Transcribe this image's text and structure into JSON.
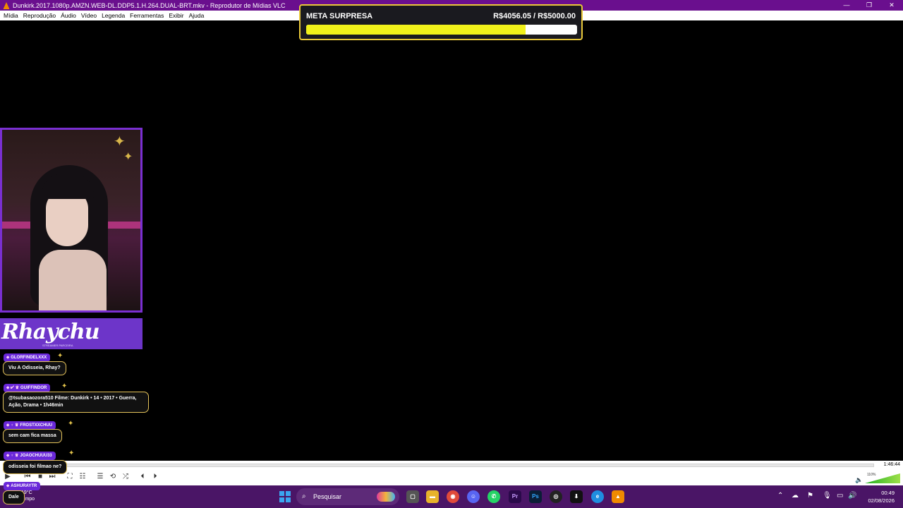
{
  "window": {
    "title": "Dunkirk.2017.1080p.AMZN.WEB-DL.DDP5.1.H.264.DUAL-BRT.mkv - Reprodutor de Mídias VLC",
    "minimize": "—",
    "maximize": "❐",
    "close": "✕"
  },
  "menu": [
    "Mídia",
    "Reprodução",
    "Áudio",
    "Vídeo",
    "Legenda",
    "Ferramentas",
    "Exibir",
    "Ajuda"
  ],
  "goal": {
    "title": "META SURPRESA",
    "amount": "R$4056.05 / R$5000.00",
    "progress": 0.811,
    "fill_color": "#f1f11a",
    "border_color": "#e9c83a"
  },
  "overlay": {
    "streamer_name": "Rhaychu",
    "banner_sub": "STREAMER PARCEIRA",
    "accent": "#6d35c9"
  },
  "chat": [
    {
      "user": "GLORFINDELXXX",
      "badges": "⬥",
      "message": "Viu A Odisseia, Rhay?"
    },
    {
      "user": "GUIFFINDOR",
      "badges": "⬥ ✔ ♛",
      "message": "@tsubasaozora510 Filme: Dunkirk • 14 • 2017 • Guerra, Ação, Drama • 1h46min"
    },
    {
      "user": "FROSTXXCHUU",
      "badges": "⬥ ♆ ♛",
      "message": "sem cam fica massa"
    },
    {
      "user": "JOAOCHUUU33",
      "badges": "⬥ ♆ ♛",
      "message": "odisseia foi filmao ne?"
    },
    {
      "user": "ASHURAYTR",
      "badges": "⬥",
      "message": "Dale"
    }
  ],
  "player": {
    "duration": "1:46:44",
    "position_fraction": 0.0,
    "volume": "110%",
    "volume_fraction": 1.0
  },
  "taskbar": {
    "weather_temp": "19°C",
    "weather_desc": "Limpo",
    "search_placeholder": "Pesquisar",
    "time": "00:49",
    "date": "02/08/2026"
  }
}
